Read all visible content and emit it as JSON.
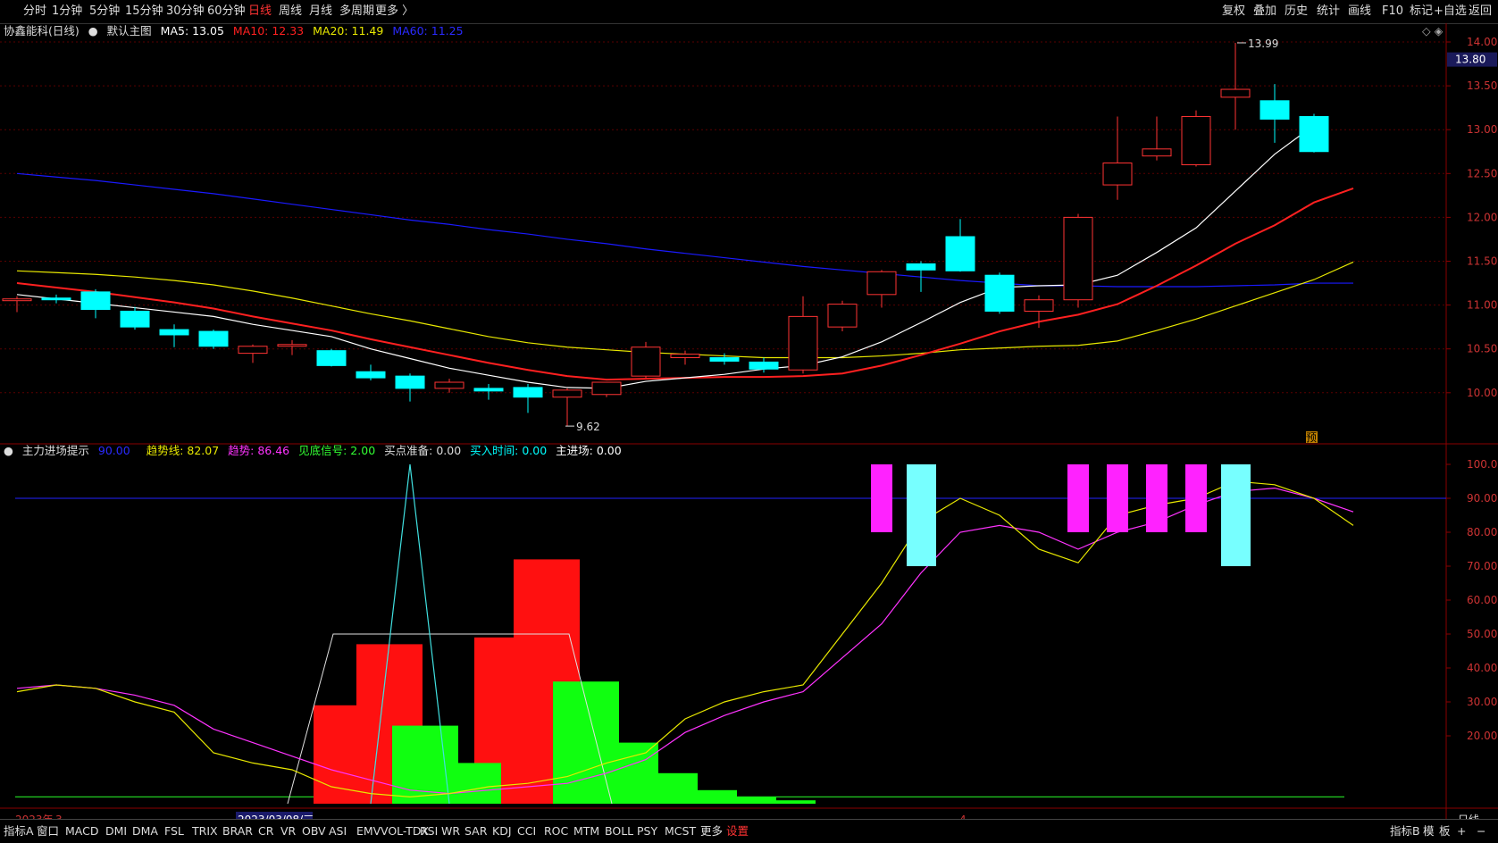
{
  "top_menu": {
    "left": [
      "分时",
      "1分钟",
      "5分钟",
      "15分钟",
      "30分钟",
      "60分钟",
      "日线",
      "周线",
      "月线",
      "多周期",
      "更多 〉"
    ],
    "active": "日线",
    "right": [
      "复权",
      "叠加",
      "历史",
      "统计",
      "画线",
      "F10",
      "标记",
      "+自选",
      "返回"
    ]
  },
  "main_info": {
    "stock": "协鑫能科(日线)",
    "main_chart_label": "默认主图",
    "ma5": "MA5: 13.05",
    "ma10": "MA10: 12.33",
    "ma20": "MA20: 11.49",
    "ma60": "MA60: 11.25",
    "right_icons": "◇ ◈"
  },
  "colors": {
    "up": "#ff3333",
    "down": "#00ffff",
    "ma5": "#ffffff",
    "ma10": "#ff2020",
    "ma20": "#e8e800",
    "ma60": "#1a1aff",
    "grid": "#5a0000"
  },
  "sub_info": {
    "title": "主力进场提示",
    "v1": "90.00",
    "trend_line": "趋势线: 82.07",
    "trend": "趋势: 86.46",
    "bottom_signal": "见底信号: 2.00",
    "buy_prep": "买点准备: 0.00",
    "buy_time": "买入时间: 0.00",
    "main_entry": "主进场: 0.00"
  },
  "price_axis": {
    "labels": [
      "14.00",
      "13.50",
      "13.00",
      "12.50",
      "12.00",
      "11.50",
      "11.00",
      "10.50",
      "10.00"
    ],
    "current": "13.80",
    "high_label": "13.99",
    "low_label": "9.62",
    "forecast_badge": "预"
  },
  "sub_axis": {
    "labels": [
      "100.0",
      "90.00",
      "80.00",
      "70.00",
      "60.00",
      "50.00",
      "40.00",
      "30.00",
      "20.00"
    ]
  },
  "date_axis": {
    "year_label": "2023年",
    "month3": "3",
    "cursor_date": "2023/03/08/三",
    "month4": "4",
    "period": "日线"
  },
  "bottom_menu": {
    "items": [
      "指标A",
      "窗口",
      "MACD",
      "DMI",
      "DMA",
      "FSL",
      "TRIX",
      "BRAR",
      "CR",
      "VR",
      "OBV",
      "ASI",
      "EMV",
      "VOL-TDX",
      "RSI",
      "WR",
      "SAR",
      "KDJ",
      "CCI",
      "ROC",
      "MTM",
      "BOLL",
      "PSY",
      "MCST",
      "更多",
      "设置"
    ],
    "right": [
      "指标B",
      "模",
      "板",
      "+",
      "−"
    ]
  },
  "chart_data": [
    {
      "type": "candlestick",
      "title": "协鑫能科(日线)",
      "ylim": [
        9.45,
        14.1
      ],
      "candles": [
        {
          "o": 11.05,
          "h": 11.1,
          "l": 10.92,
          "c": 11.07
        },
        {
          "o": 11.08,
          "h": 11.12,
          "l": 11.02,
          "c": 11.06
        },
        {
          "o": 11.15,
          "h": 11.18,
          "l": 10.85,
          "c": 10.95
        },
        {
          "o": 10.93,
          "h": 10.98,
          "l": 10.72,
          "c": 10.75
        },
        {
          "o": 10.72,
          "h": 10.78,
          "l": 10.52,
          "c": 10.66
        },
        {
          "o": 10.7,
          "h": 10.72,
          "l": 10.5,
          "c": 10.53
        },
        {
          "o": 10.45,
          "h": 10.55,
          "l": 10.34,
          "c": 10.53
        },
        {
          "o": 10.53,
          "h": 10.6,
          "l": 10.43,
          "c": 10.55
        },
        {
          "o": 10.48,
          "h": 10.5,
          "l": 10.3,
          "c": 10.31
        },
        {
          "o": 10.24,
          "h": 10.32,
          "l": 10.14,
          "c": 10.17
        },
        {
          "o": 10.19,
          "h": 10.22,
          "l": 9.9,
          "c": 10.05
        },
        {
          "o": 10.05,
          "h": 10.16,
          "l": 10.0,
          "c": 10.12
        },
        {
          "o": 10.05,
          "h": 10.1,
          "l": 9.92,
          "c": 10.02
        },
        {
          "o": 10.06,
          "h": 10.1,
          "l": 9.77,
          "c": 9.95
        },
        {
          "o": 9.95,
          "h": 10.05,
          "l": 9.62,
          "c": 10.03
        },
        {
          "o": 9.98,
          "h": 10.12,
          "l": 9.95,
          "c": 10.12
        },
        {
          "o": 10.19,
          "h": 10.58,
          "l": 10.17,
          "c": 10.52
        },
        {
          "o": 10.4,
          "h": 10.48,
          "l": 10.32,
          "c": 10.44
        },
        {
          "o": 10.4,
          "h": 10.45,
          "l": 10.32,
          "c": 10.36
        },
        {
          "o": 10.35,
          "h": 10.4,
          "l": 10.23,
          "c": 10.27
        },
        {
          "o": 10.26,
          "h": 11.1,
          "l": 10.22,
          "c": 10.87
        },
        {
          "o": 10.75,
          "h": 11.05,
          "l": 10.7,
          "c": 11.01
        },
        {
          "o": 11.12,
          "h": 11.4,
          "l": 10.97,
          "c": 11.38
        },
        {
          "o": 11.47,
          "h": 11.5,
          "l": 11.15,
          "c": 11.4
        },
        {
          "o": 11.78,
          "h": 11.98,
          "l": 11.38,
          "c": 11.39
        },
        {
          "o": 11.34,
          "h": 11.37,
          "l": 10.9,
          "c": 10.93
        },
        {
          "o": 10.93,
          "h": 11.11,
          "l": 10.74,
          "c": 11.06
        },
        {
          "o": 11.06,
          "h": 12.04,
          "l": 10.97,
          "c": 12.0
        },
        {
          "o": 12.37,
          "h": 13.15,
          "l": 12.2,
          "c": 12.62
        },
        {
          "o": 12.7,
          "h": 13.15,
          "l": 12.65,
          "c": 12.78
        },
        {
          "o": 12.6,
          "h": 13.22,
          "l": 12.58,
          "c": 13.15
        },
        {
          "o": 13.37,
          "h": 13.99,
          "l": 13.0,
          "c": 13.46
        },
        {
          "o": 13.33,
          "h": 13.52,
          "l": 12.85,
          "c": 13.12
        },
        {
          "o": 13.15,
          "h": 13.18,
          "l": 12.74,
          "c": 12.75
        }
      ],
      "ma5": [
        11.12,
        11.07,
        11.02,
        10.97,
        10.92,
        10.87,
        10.78,
        10.71,
        10.64,
        10.5,
        10.39,
        10.28,
        10.2,
        10.12,
        10.06,
        10.05,
        10.13,
        10.17,
        10.21,
        10.27,
        10.31,
        10.41,
        10.58,
        10.8,
        11.03,
        11.2,
        11.22,
        11.23,
        11.34,
        11.6,
        11.88,
        12.3,
        12.72,
        13.05
      ],
      "ma10": [
        11.25,
        11.2,
        11.15,
        11.09,
        11.03,
        10.96,
        10.87,
        10.79,
        10.71,
        10.61,
        10.52,
        10.43,
        10.34,
        10.26,
        10.19,
        10.15,
        10.16,
        10.17,
        10.18,
        10.18,
        10.19,
        10.22,
        10.31,
        10.43,
        10.56,
        10.7,
        10.81,
        10.89,
        11.01,
        11.22,
        11.45,
        11.7,
        11.91,
        12.17,
        12.33
      ],
      "ma20": [
        11.39,
        11.37,
        11.35,
        11.32,
        11.28,
        11.23,
        11.16,
        11.08,
        10.99,
        10.9,
        10.82,
        10.73,
        10.64,
        10.57,
        10.52,
        10.49,
        10.46,
        10.44,
        10.42,
        10.4,
        10.4,
        10.4,
        10.42,
        10.45,
        10.49,
        10.51,
        10.53,
        10.54,
        10.59,
        10.71,
        10.84,
        10.99,
        11.14,
        11.29,
        11.49
      ],
      "ma60": [
        12.5,
        12.46,
        12.42,
        12.37,
        12.32,
        12.27,
        12.21,
        12.15,
        12.09,
        12.03,
        11.97,
        11.92,
        11.86,
        11.81,
        11.75,
        11.7,
        11.64,
        11.59,
        11.54,
        11.49,
        11.44,
        11.4,
        11.36,
        11.32,
        11.28,
        11.25,
        11.22,
        11.22,
        11.21,
        11.21,
        11.21,
        11.22,
        11.23,
        11.25,
        11.25
      ]
    },
    {
      "type": "indicator",
      "title": "主力进场提示",
      "ylim": [
        0,
        100
      ],
      "level_line": 90,
      "trend_line": [
        33,
        35,
        34,
        30,
        27,
        15,
        12,
        10,
        5,
        3,
        2,
        3,
        5,
        6,
        8,
        12,
        15,
        25,
        30,
        33,
        35,
        50,
        65,
        83,
        90,
        85,
        75,
        71,
        85,
        88,
        90,
        95,
        94,
        90,
        82
      ],
      "trend": [
        34,
        35,
        34,
        32,
        29,
        22,
        18,
        14,
        10,
        7,
        4,
        3,
        4,
        5,
        6,
        9,
        13,
        21,
        26,
        30,
        33,
        43,
        53,
        68,
        80,
        82,
        80,
        75,
        80,
        83,
        88,
        92,
        93,
        90,
        86
      ],
      "white_line": [
        0,
        0,
        0,
        0,
        0,
        0,
        0,
        50,
        50,
        50,
        50,
        50,
        50,
        50,
        50,
        0,
        0,
        0,
        0,
        0,
        0,
        0,
        0,
        0,
        0,
        0,
        0,
        0,
        0,
        0,
        0,
        0,
        0,
        0,
        0
      ],
      "cyan_spike_index": 10,
      "red_bars": [
        {
          "i": 8,
          "v": 29
        },
        {
          "i": 9,
          "v": 47
        },
        {
          "i": 12,
          "v": 49
        },
        {
          "i": 13,
          "v": 72
        }
      ],
      "green_bars": [
        {
          "i": 10,
          "v": 23
        },
        {
          "i": 11,
          "v": 12
        },
        {
          "i": 14,
          "v": 36
        },
        {
          "i": 15,
          "v": 18
        },
        {
          "i": 16,
          "v": 9
        },
        {
          "i": 17,
          "v": 4
        },
        {
          "i": 18,
          "v": 2
        },
        {
          "i": 19,
          "v": 1
        }
      ],
      "magenta_signals": [
        22,
        27,
        28,
        29,
        30
      ],
      "cyan_signals": [
        23,
        31
      ]
    }
  ]
}
